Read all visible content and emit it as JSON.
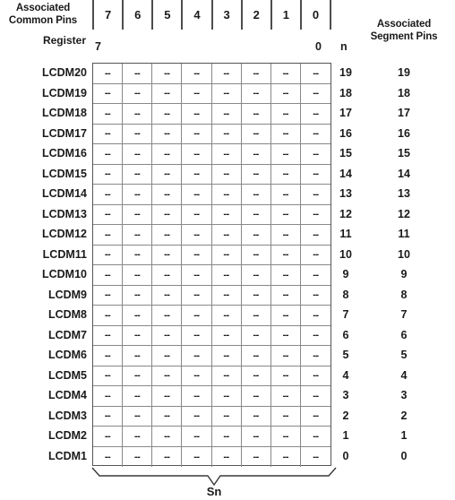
{
  "headers": {
    "common_pins": "Associated\nCommon Pins",
    "common_pins_line1": "Associated",
    "common_pins_line2": "Common Pins",
    "register": "Register",
    "segment_pins_line1": "Associated",
    "segment_pins_line2": "Segment Pins",
    "n_column": "n",
    "bit_msb": "7",
    "bit_lsb": "0"
  },
  "common_pin_numbers": [
    "7",
    "6",
    "5",
    "4",
    "3",
    "2",
    "1",
    "0"
  ],
  "cell_value": "--",
  "rows": [
    {
      "register": "LCDM20",
      "n": "19",
      "segment_pin": "19"
    },
    {
      "register": "LCDM19",
      "n": "18",
      "segment_pin": "18"
    },
    {
      "register": "LCDM18",
      "n": "17",
      "segment_pin": "17"
    },
    {
      "register": "LCDM17",
      "n": "16",
      "segment_pin": "16"
    },
    {
      "register": "LCDM16",
      "n": "15",
      "segment_pin": "15"
    },
    {
      "register": "LCDM15",
      "n": "14",
      "segment_pin": "14"
    },
    {
      "register": "LCDM14",
      "n": "13",
      "segment_pin": "13"
    },
    {
      "register": "LCDM13",
      "n": "12",
      "segment_pin": "12"
    },
    {
      "register": "LCDM12",
      "n": "11",
      "segment_pin": "11"
    },
    {
      "register": "LCDM11",
      "n": "10",
      "segment_pin": "10"
    },
    {
      "register": "LCDM10",
      "n": "9",
      "segment_pin": "9"
    },
    {
      "register": "LCDM9",
      "n": "8",
      "segment_pin": "8"
    },
    {
      "register": "LCDM8",
      "n": "7",
      "segment_pin": "7"
    },
    {
      "register": "LCDM7",
      "n": "6",
      "segment_pin": "6"
    },
    {
      "register": "LCDM6",
      "n": "5",
      "segment_pin": "5"
    },
    {
      "register": "LCDM5",
      "n": "4",
      "segment_pin": "4"
    },
    {
      "register": "LCDM4",
      "n": "3",
      "segment_pin": "3"
    },
    {
      "register": "LCDM3",
      "n": "2",
      "segment_pin": "2"
    },
    {
      "register": "LCDM2",
      "n": "1",
      "segment_pin": "1"
    },
    {
      "register": "LCDM1",
      "n": "0",
      "segment_pin": "0"
    }
  ],
  "brace_label": "Sn",
  "colors": {
    "text": "#1a1a1a",
    "grid_border": "#888888",
    "grid_outer_border": "#555555",
    "header_rule": "#4d4d4d",
    "background": "#ffffff"
  }
}
